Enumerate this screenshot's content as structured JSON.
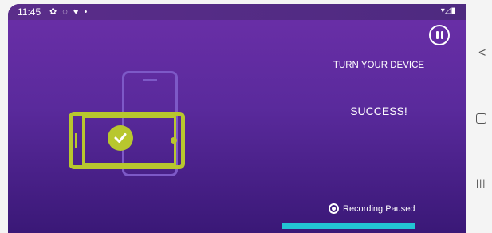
{
  "status_bar": {
    "time": "11:45",
    "icons": "✿ ◌ ♥ •",
    "right": "▾◿▮"
  },
  "instruction": "TURN YOUR DEVICE",
  "result": "SUCCESS!",
  "recording_status": "Recording Paused",
  "nav": {
    "back_icon": "<",
    "recent_icon": "|||"
  },
  "colors": {
    "accent": "#b8c72e",
    "background": "#5a2a9c",
    "bar": "#22c4d4"
  }
}
